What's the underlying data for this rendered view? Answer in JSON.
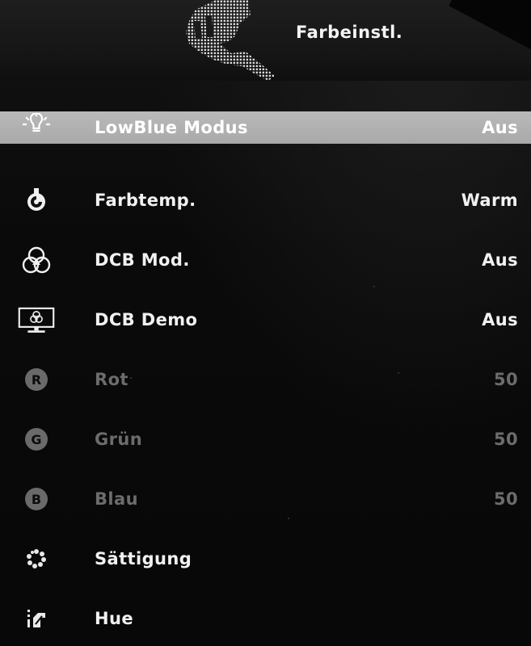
{
  "header": {
    "title": "Farbeinstl.",
    "icon": "color-settings-icon"
  },
  "menu": {
    "items": [
      {
        "label": "LowBlue Modus",
        "value": "Aus",
        "icon": "bulb-icon",
        "selected": true,
        "enabled": true
      },
      {
        "label": "Farbtemp.",
        "value": "Warm",
        "icon": "thermometer-icon",
        "selected": false,
        "enabled": true
      },
      {
        "label": "DCB Mod.",
        "value": "Aus",
        "icon": "rgb-circles-icon",
        "selected": false,
        "enabled": true
      },
      {
        "label": "DCB Demo",
        "value": "Aus",
        "icon": "monitor-demo-icon",
        "selected": false,
        "enabled": true
      },
      {
        "label": "Rot",
        "value": "50",
        "icon": "r-circle-icon",
        "selected": false,
        "enabled": false
      },
      {
        "label": "Grün",
        "value": "50",
        "icon": "g-circle-icon",
        "selected": false,
        "enabled": false
      },
      {
        "label": "Blau",
        "value": "50",
        "icon": "b-circle-icon",
        "selected": false,
        "enabled": false
      },
      {
        "label": "Sättigung",
        "value": "",
        "icon": "saturation-icon",
        "selected": false,
        "enabled": true
      },
      {
        "label": "Hue",
        "value": "",
        "icon": "hue-icon",
        "selected": false,
        "enabled": true
      }
    ]
  },
  "colors": {
    "selection_bar": "#b0b0b0",
    "text": "#f1f1f1",
    "text_disabled": "#6c6c6c",
    "background": "#0a0a0a"
  }
}
